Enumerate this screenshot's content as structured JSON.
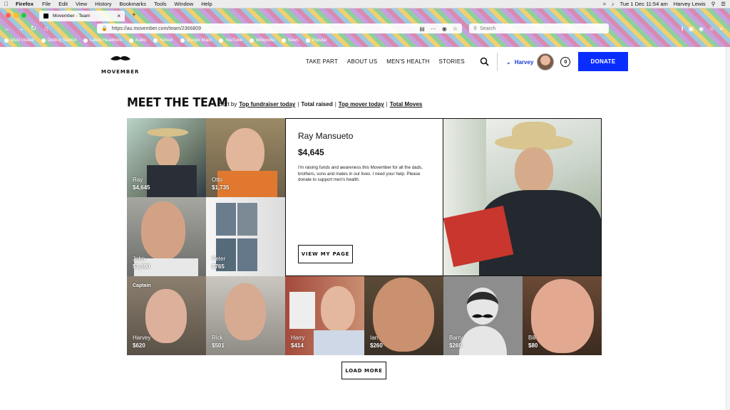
{
  "menubar": {
    "app": "Firefox",
    "items": [
      "File",
      "Edit",
      "View",
      "History",
      "Bookmarks",
      "Tools",
      "Window",
      "Help"
    ],
    "clock": "Tue 1 Dec  11:54 am",
    "user": "Harvey Lewis"
  },
  "browser": {
    "tab_title": "Movember - Team",
    "url": "https://au.movember.com/team/2366809",
    "search_placeholder": "Search",
    "bookmarks": [
      "Most Visited",
      "Getting Started",
      "Latest Headlines",
      "Audio",
      "Yahoo!",
      "Google Maps",
      "YouTube",
      "Wikipedia",
      "News",
      "Popular"
    ]
  },
  "site": {
    "logo": "MOVEMBER",
    "nav": [
      "TAKE PART",
      "ABOUT US",
      "MEN'S HEALTH",
      "STORIES"
    ],
    "user": "Harvey",
    "cart_count": "0",
    "donate": "DONATE"
  },
  "team": {
    "title": "MEET THE TEAM",
    "sort_label": "Sort by",
    "sort_options": [
      "Top fundraiser today",
      "Total raised",
      "Top mover today",
      "Total Moves"
    ],
    "members": [
      {
        "name": "Ray",
        "amount": "$4,645"
      },
      {
        "name": "Otto",
        "amount": "$1,735"
      },
      {
        "name": "John",
        "amount": "$1,090"
      },
      {
        "name": "Peter",
        "amount": "$765"
      },
      {
        "name": "Harvey",
        "amount": "$620",
        "caption": "Captain"
      },
      {
        "name": "Rick",
        "amount": "$501"
      },
      {
        "name": "Harry",
        "amount": "$414"
      },
      {
        "name": "Ian",
        "amount": "$260"
      },
      {
        "name": "Barry",
        "amount": "$260"
      },
      {
        "name": "Bill",
        "amount": "$80"
      }
    ],
    "featured": {
      "name": "Ray Mansueto",
      "raised": "$4,645",
      "story": "I'm raising funds and awareness this Movember for all the dads, brothers, sons and mates in our lives. I need your help. Please donate to support men's health.",
      "view_button": "VIEW MY PAGE"
    },
    "load_more": "LOAD MORE"
  },
  "colors": {
    "donate": "#0a2dff",
    "user_link": "#1a3cd6"
  }
}
